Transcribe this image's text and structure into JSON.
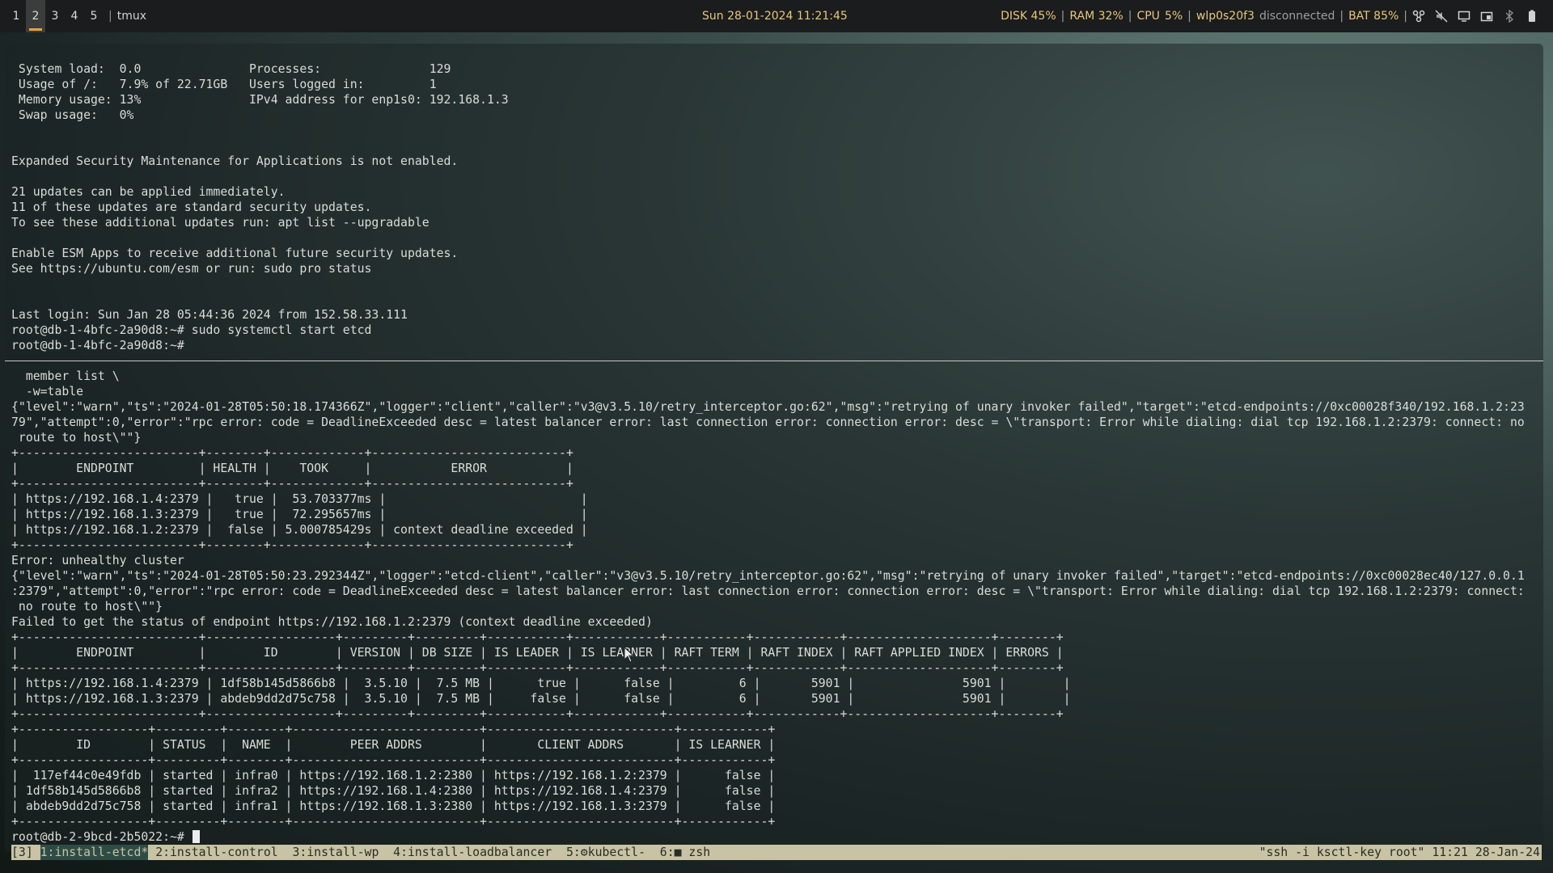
{
  "topbar": {
    "workspaces": [
      "1",
      "2",
      "3",
      "4",
      "5"
    ],
    "active_workspace": "2",
    "window_title": "tmux",
    "datetime": "Sun 28-01-2024 11:21:45",
    "disk": "DISK 45%",
    "ram": "RAM 32%",
    "cpu_label": "CPU",
    "cpu_value": "5%",
    "wifi_iface": "wlp0s20f3",
    "wifi_status": "disconnected",
    "battery": "BAT 85%",
    "tray_icons": [
      "network-icon",
      "volume-muted-icon",
      "display-icon",
      "screenshot-icon",
      "bluetooth-off-icon",
      "battery-icon"
    ]
  },
  "terminal": {
    "pane1_text": " System load:  0.0               Processes:               129\n Usage of /:   7.9% of 22.71GB   Users logged in:         1\n Memory usage: 13%               IPv4 address for enp1s0: 192.168.1.3\n Swap usage:   0%\n\n\nExpanded Security Maintenance for Applications is not enabled.\n\n21 updates can be applied immediately.\n11 of these updates are standard security updates.\nTo see these additional updates run: apt list --upgradable\n\nEnable ESM Apps to receive additional future security updates.\nSee https://ubuntu.com/esm or run: sudo pro status\n\n\nLast login: Sun Jan 28 05:44:36 2024 from 152.58.33.111\nroot@db-1-4bfc-2a90d8:~# sudo systemctl start etcd\nroot@db-1-4bfc-2a90d8:~#",
    "pane2_text": "  member list \\\n  -w=table\n{\"level\":\"warn\",\"ts\":\"2024-01-28T05:50:18.174366Z\",\"logger\":\"client\",\"caller\":\"v3@v3.5.10/retry_interceptor.go:62\",\"msg\":\"retrying of unary invoker failed\",\"target\":\"etcd-endpoints://0xc00028f340/192.168.1.2:23\n79\",\"attempt\":0,\"error\":\"rpc error: code = DeadlineExceeded desc = latest balancer error: last connection error: connection error: desc = \\\"transport: Error while dialing: dial tcp 192.168.1.2:2379: connect: no\n route to host\\\"\"}\n+-------------------------+--------+-------------+---------------------------+\n|        ENDPOINT         | HEALTH |    TOOK     |           ERROR           |\n+-------------------------+--------+-------------+---------------------------+\n| https://192.168.1.4:2379 |   true |  53.703377ms |                           |\n| https://192.168.1.3:2379 |   true |  72.295657ms |                           |\n| https://192.168.1.2:2379 |  false | 5.000785429s | context deadline exceeded |\n+-------------------------+--------+-------------+---------------------------+\nError: unhealthy cluster\n{\"level\":\"warn\",\"ts\":\"2024-01-28T05:50:23.292344Z\",\"logger\":\"etcd-client\",\"caller\":\"v3@v3.5.10/retry_interceptor.go:62\",\"msg\":\"retrying of unary invoker failed\",\"target\":\"etcd-endpoints://0xc00028ec40/127.0.0.1\n:2379\",\"attempt\":0,\"error\":\"rpc error: code = DeadlineExceeded desc = latest balancer error: last connection error: connection error: desc = \\\"transport: Error while dialing: dial tcp 192.168.1.2:2379: connect:\n no route to host\\\"\"}\nFailed to get the status of endpoint https://192.168.1.2:2379 (context deadline exceeded)\n+-------------------------+------------------+---------+---------+-----------+------------+-----------+------------+--------------------+--------+\n|        ENDPOINT         |        ID        | VERSION | DB SIZE | IS LEADER | IS LEARNER | RAFT TERM | RAFT INDEX | RAFT APPLIED INDEX | ERRORS |\n+-------------------------+------------------+---------+---------+-----------+------------+-----------+------------+--------------------+--------+\n| https://192.168.1.4:2379 | 1df58b145d5866b8 |  3.5.10 |  7.5 MB |      true |      false |         6 |       5901 |               5901 |        |\n| https://192.168.1.3:2379 | abdeb9dd2d75c758 |  3.5.10 |  7.5 MB |     false |      false |         6 |       5901 |               5901 |        |\n+-------------------------+------------------+---------+---------+-----------+------------+-----------+------------+--------------------+--------+\n+------------------+---------+--------+--------------------------+--------------------------+------------+\n|        ID        | STATUS  |  NAME  |        PEER ADDRS        |       CLIENT ADDRS       | IS LEARNER |\n+------------------+---------+--------+--------------------------+--------------------------+------------+\n|  117ef44c0e49fdb | started | infra0 | https://192.168.1.2:2380 | https://192.168.1.2:2379 |      false |\n| 1df58b145d5866b8 | started | infra2 | https://192.168.1.4:2380 | https://192.168.1.4:2379 |      false |\n| abdeb9dd2d75c758 | started | infra1 | https://192.168.1.3:2380 | https://192.168.1.3:2379 |      false |\n+------------------+---------+--------+--------------------------+--------------------------+------------+",
    "prompt": "root@db-2-9bcd-2b5022:~# "
  },
  "tmux": {
    "session": "[3] ",
    "windows": [
      {
        "label": "1:install-etcd*",
        "current": true
      },
      {
        "label": " 2:install-control ",
        "current": false
      },
      {
        "label": " 3:install-wp ",
        "current": false
      },
      {
        "label": " 4:install-loadbalancer ",
        "current": false
      },
      {
        "label": " 5:⚙kubectl- ",
        "current": false
      },
      {
        "label": " 6:■ zsh",
        "current": false
      }
    ],
    "right_status": "\"ssh -i ksctl-key root\" 11:21 28-Jan-24"
  }
}
